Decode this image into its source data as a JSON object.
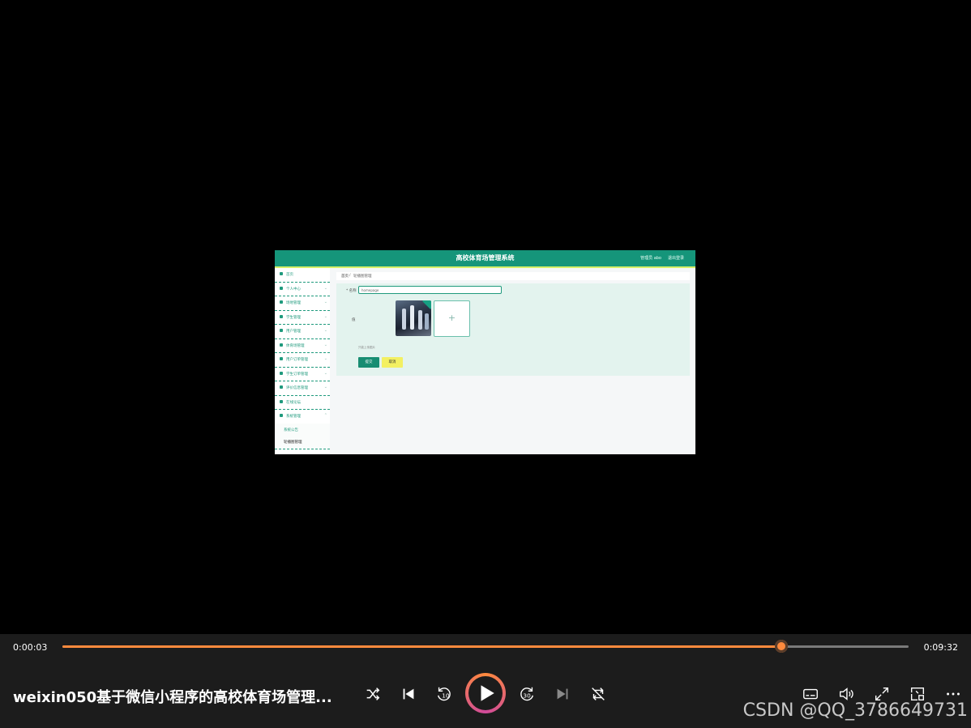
{
  "app": {
    "title": "高校体育场管理系统",
    "user_label": "管理员 abo",
    "logout_label": "退出登录",
    "sidebar": {
      "items": [
        {
          "label": "首页",
          "has_children": false
        },
        {
          "label": "个人中心",
          "has_children": true
        },
        {
          "label": "场地管理",
          "has_children": true
        },
        {
          "label": "学生管理",
          "has_children": true
        },
        {
          "label": "用户管理",
          "has_children": true
        },
        {
          "label": "体育场管理",
          "has_children": true
        },
        {
          "label": "用户订单管理",
          "has_children": true
        },
        {
          "label": "学生订单管理",
          "has_children": true
        },
        {
          "label": "评价信息管理",
          "has_children": true
        },
        {
          "label": "在线论坛",
          "has_children": false
        },
        {
          "label": "系统管理",
          "has_children": true
        }
      ],
      "sub_items": [
        {
          "label": "系统公告",
          "active": false
        },
        {
          "label": "轮播图管理",
          "active": true
        }
      ]
    },
    "breadcrumb": {
      "home": "首页",
      "sep": "/",
      "current": "轮播图管理"
    },
    "form": {
      "title_label": "* 名称",
      "title_value": "homepage",
      "image_label": "值",
      "hint": "只能上传图片",
      "submit_label": "提交",
      "cancel_label": "取消"
    }
  },
  "player": {
    "current_time": "0:00:03",
    "total_time": "0:09:32",
    "progress": 0.85,
    "video_title": "weixin050基于微信小程序的高校体育场管理...",
    "watermark": "CSDN @QQ_3786649731",
    "accent_color": "#ff8a3d",
    "controls": [
      "shuffle-icon",
      "previous-icon",
      "rewind-10-icon",
      "play-icon",
      "forward-30-icon",
      "next-icon",
      "repeat-icon",
      "subtitles-icon",
      "volume-icon",
      "fullscreen-icon",
      "mini-player-icon",
      "more-icon"
    ]
  }
}
